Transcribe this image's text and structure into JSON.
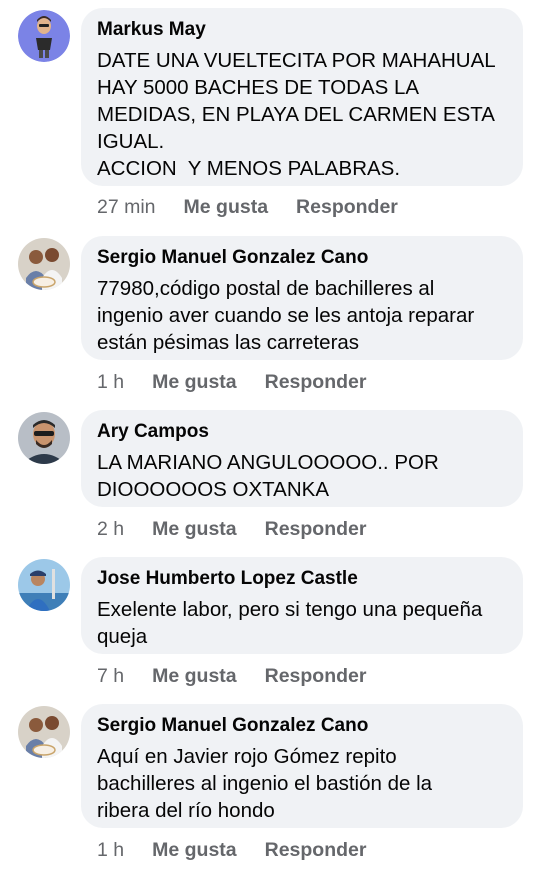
{
  "comments": [
    {
      "author": "Markus May",
      "avatar_icon": "bitmoji-avatar",
      "lines": [
        "DATE UNA VUELTECITA POR MAHAHUAL",
        "HAY 5000 BACHES DE TODAS LA",
        "MEDIDAS, EN PLAYA DEL CARMEN ESTA",
        "IGUAL.",
        "ACCION  Y MENOS PALABRAS."
      ],
      "time": "27 min",
      "like": "Me gusta",
      "reply": "Responder"
    },
    {
      "author": "Sergio Manuel Gonzalez Cano",
      "avatar_icon": "couple-photo-avatar",
      "lines": [
        "77980,código postal de bachilleres al",
        "ingenio aver cuando se les antoja reparar",
        "están pésimas las carreteras"
      ],
      "time": "1 h",
      "like": "Me gusta",
      "reply": "Responder"
    },
    {
      "author": "Ary Campos",
      "avatar_icon": "man-sunglasses-avatar",
      "lines": [
        "LA MARIANO ANGULOOOOO.. POR",
        "DIOOOOOOS OXTANKA"
      ],
      "time": "2 h",
      "like": "Me gusta",
      "reply": "Responder"
    },
    {
      "author": "Jose Humberto Lopez Castle",
      "avatar_icon": "man-outdoors-avatar",
      "lines": [
        "Exelente labor, pero si tengo una pequeña",
        "queja"
      ],
      "time": "7 h",
      "like": "Me gusta",
      "reply": "Responder"
    },
    {
      "author": "Sergio Manuel Gonzalez Cano",
      "avatar_icon": "couple-photo-avatar",
      "lines": [
        "Aquí en Javier rojo Gómez repito",
        "bachilleres al ingenio el bastión de la",
        "ribera del río hondo"
      ],
      "time": "1 h",
      "like": "Me gusta",
      "reply": "Responder"
    }
  ]
}
